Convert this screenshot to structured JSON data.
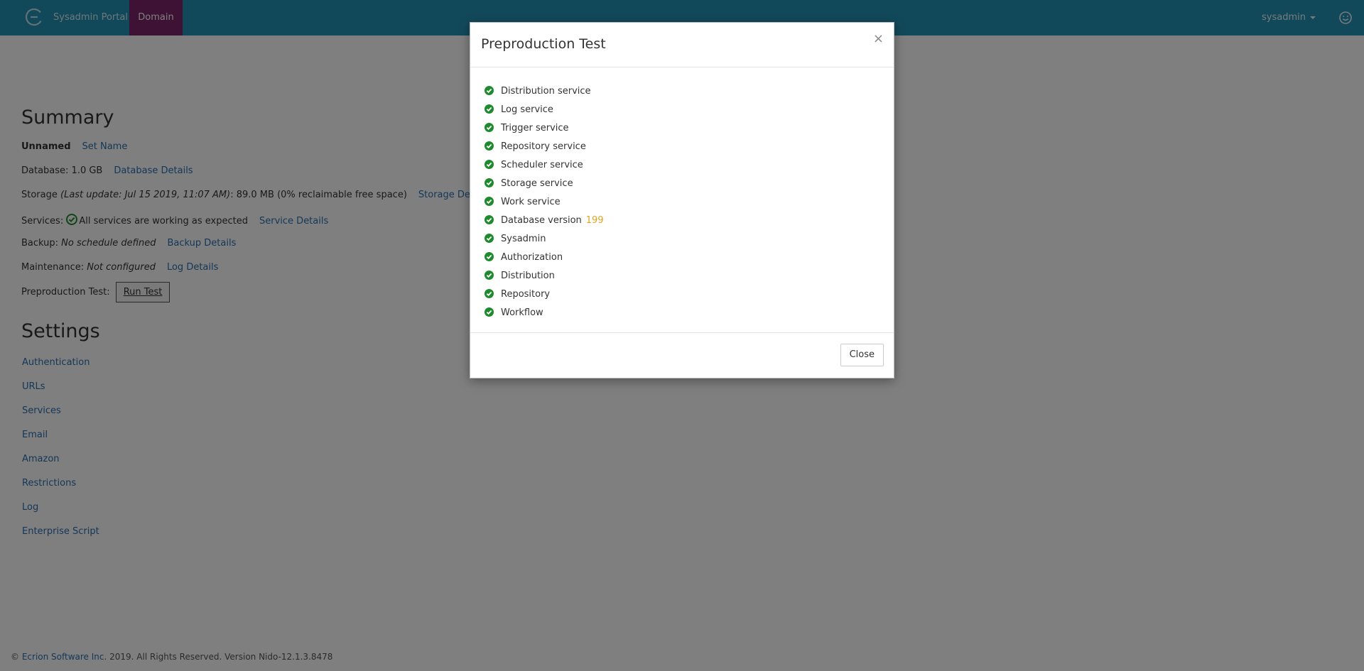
{
  "nav": {
    "brand": "Sysadmin Portal",
    "active_tab": "Domain",
    "user": "sysadmin",
    "logo_icon": "ecrion-logo-icon",
    "user_icon": "smiley-icon"
  },
  "summary": {
    "title": "Summary",
    "name_label": "Unnamed",
    "set_name_link": "Set Name",
    "database_text": "Database: 1.0 GB",
    "database_link": "Database Details",
    "storage_prefix": "Storage ",
    "storage_italic": "(Last update: Jul 15 2019, 11:07 AM)",
    "storage_suffix": ": 89.0 MB (0% reclaimable free space)",
    "storage_link": "Storage Details",
    "services_prefix": "Services: ",
    "services_text": "All services are working as expected",
    "services_link": "Service Details",
    "backup_prefix": "Backup: ",
    "backup_italic": "No schedule defined",
    "backup_link": "Backup Details",
    "maintenance_prefix": "Maintenance: ",
    "maintenance_italic": "Not configured",
    "maintenance_link": "Log Details",
    "preprod_label": "Preproduction Test:",
    "run_test_button": "Run Test"
  },
  "settings": {
    "title": "Settings",
    "links": [
      "Authentication",
      "URLs",
      "Services",
      "Email",
      "Amazon",
      "Restrictions",
      "Log",
      "Enterprise Script"
    ]
  },
  "footer": {
    "copyright": "©",
    "company": "Ecrion Software Inc.",
    "rest": " 2019. All Rights Reserved. Version Nido-12.1.3.8478"
  },
  "modal": {
    "title": "Preproduction Test",
    "close_x": "×",
    "close_button": "Close",
    "items": [
      {
        "label": "Distribution service",
        "status": "ok"
      },
      {
        "label": "Log service",
        "status": "ok"
      },
      {
        "label": "Trigger service",
        "status": "ok"
      },
      {
        "label": "Repository service",
        "status": "ok"
      },
      {
        "label": "Scheduler service",
        "status": "ok"
      },
      {
        "label": "Storage service",
        "status": "ok"
      },
      {
        "label": "Work service",
        "status": "ok"
      },
      {
        "label": "Database version",
        "status": "ok",
        "value": "199"
      },
      {
        "label": "Sysadmin",
        "status": "ok"
      },
      {
        "label": "Authorization",
        "status": "ok"
      },
      {
        "label": "Distribution",
        "status": "ok"
      },
      {
        "label": "Repository",
        "status": "ok"
      },
      {
        "label": "Workflow",
        "status": "ok"
      }
    ],
    "colors": {
      "ok": "#1e8a2e",
      "version": "#e0a521"
    }
  },
  "colors": {
    "navbar": "#2593b4",
    "active_tab": "#7b2468",
    "link": "#2a6fb0",
    "overlay": "rgba(0,0,0,0.5)"
  }
}
